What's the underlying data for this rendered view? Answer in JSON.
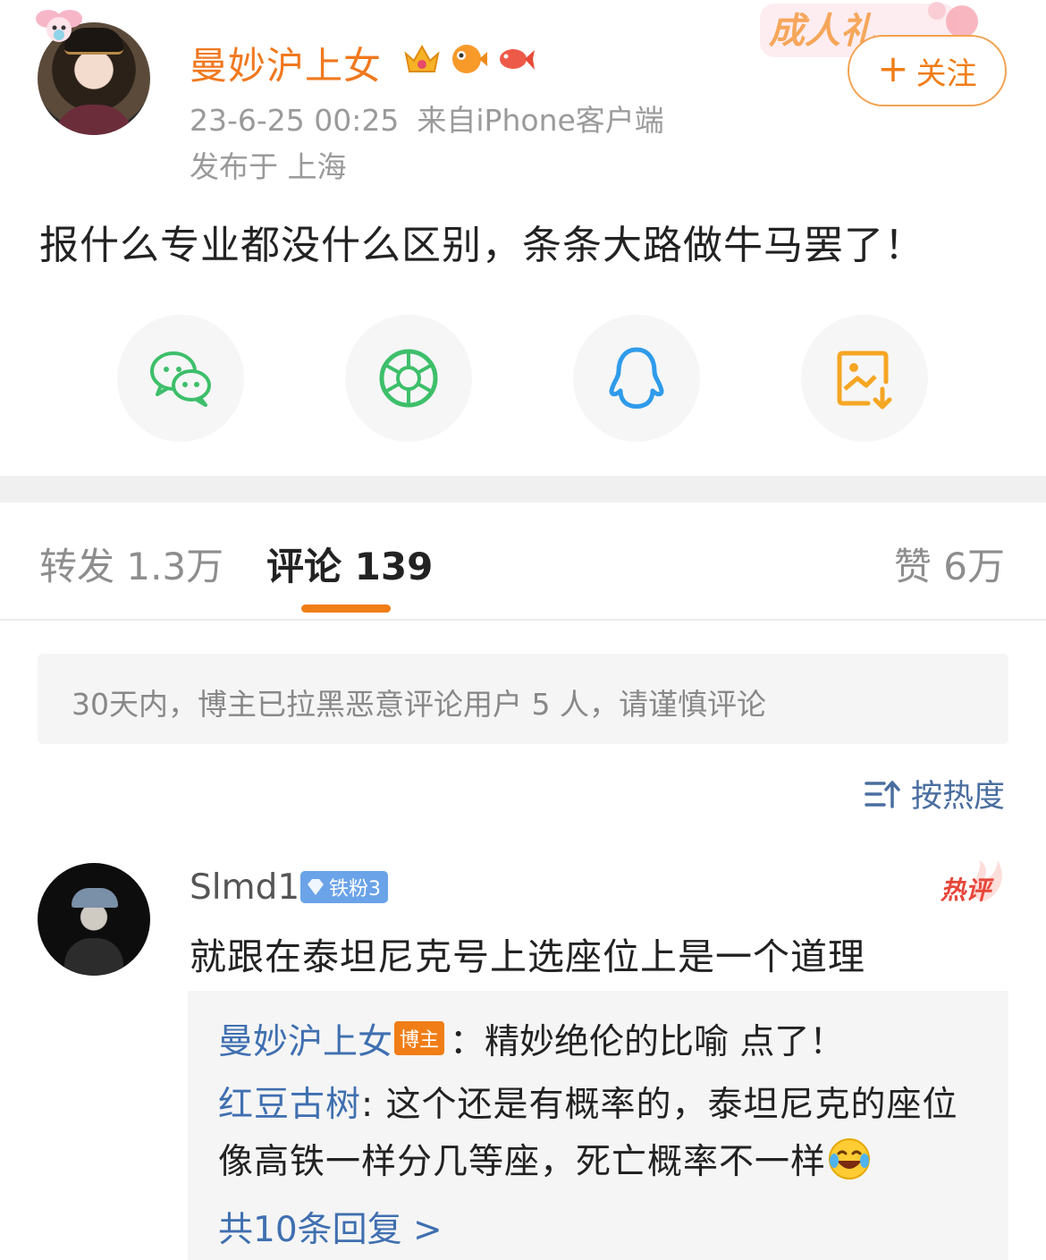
{
  "post": {
    "username": "曼妙沪上女",
    "time": "23-6-25 00:25",
    "source": "来自iPhone客户端",
    "location": "发布于 上海",
    "text": "报什么专业都没什么区别，条条大路做牛马罢了！",
    "ceremony_banner": "成人礼",
    "follow_label": "关注",
    "badges": [
      "crown-vip-icon",
      "puffer-fish-icon",
      "koi-fish-icon"
    ]
  },
  "share": [
    {
      "name": "wechat",
      "color": "#3dbf6a"
    },
    {
      "name": "moments",
      "color": "#3dbf6a"
    },
    {
      "name": "qq",
      "color": "#2f9bea"
    },
    {
      "name": "save-image",
      "color": "#f5a623"
    }
  ],
  "tabs": {
    "repost": "转发 1.3万",
    "comment": "评论 139",
    "like": "赞 6万"
  },
  "notice": "30天内，博主已拉黑恶意评论用户 5 人，请谨慎评论",
  "sort_label": "按热度",
  "comment": {
    "username": "Slmd1",
    "fan_badge": "铁粉3",
    "hot_label": "热评",
    "text": "就跟在泰坦尼克号上选座位上是一个道理",
    "replies": [
      {
        "name": "曼妙沪上女",
        "tag": "博主",
        "text": "：精妙绝伦的比喻 点了！"
      },
      {
        "name": "红豆古树",
        "text": ": 这个还是有概率的，泰坦尼克的座位像高铁一样分几等座，死亡概率不一样"
      }
    ],
    "more_replies": "共10条回复 >"
  },
  "colors": {
    "accent": "#f07d16",
    "link": "#3f6fb0",
    "muted": "#9a9a9a"
  }
}
